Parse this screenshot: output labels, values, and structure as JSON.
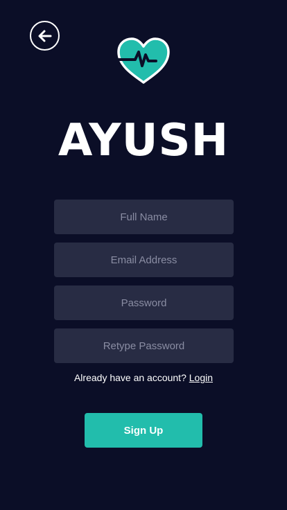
{
  "header": {
    "back_icon": "arrow-left-icon",
    "logo_icon": "heart-pulse-icon",
    "brand": "AYUSH"
  },
  "form": {
    "full_name_placeholder": "Full Name",
    "email_placeholder": "Email Address",
    "password_placeholder": "Password",
    "retype_password_placeholder": "Retype Password"
  },
  "login_prompt": {
    "text": "Already have an account?",
    "link": "Login"
  },
  "signup_button": "Sign Up",
  "colors": {
    "background": "#0b0e27",
    "field": "#282c44",
    "accent": "#22bdac",
    "heart_outline": "#ffffff"
  }
}
